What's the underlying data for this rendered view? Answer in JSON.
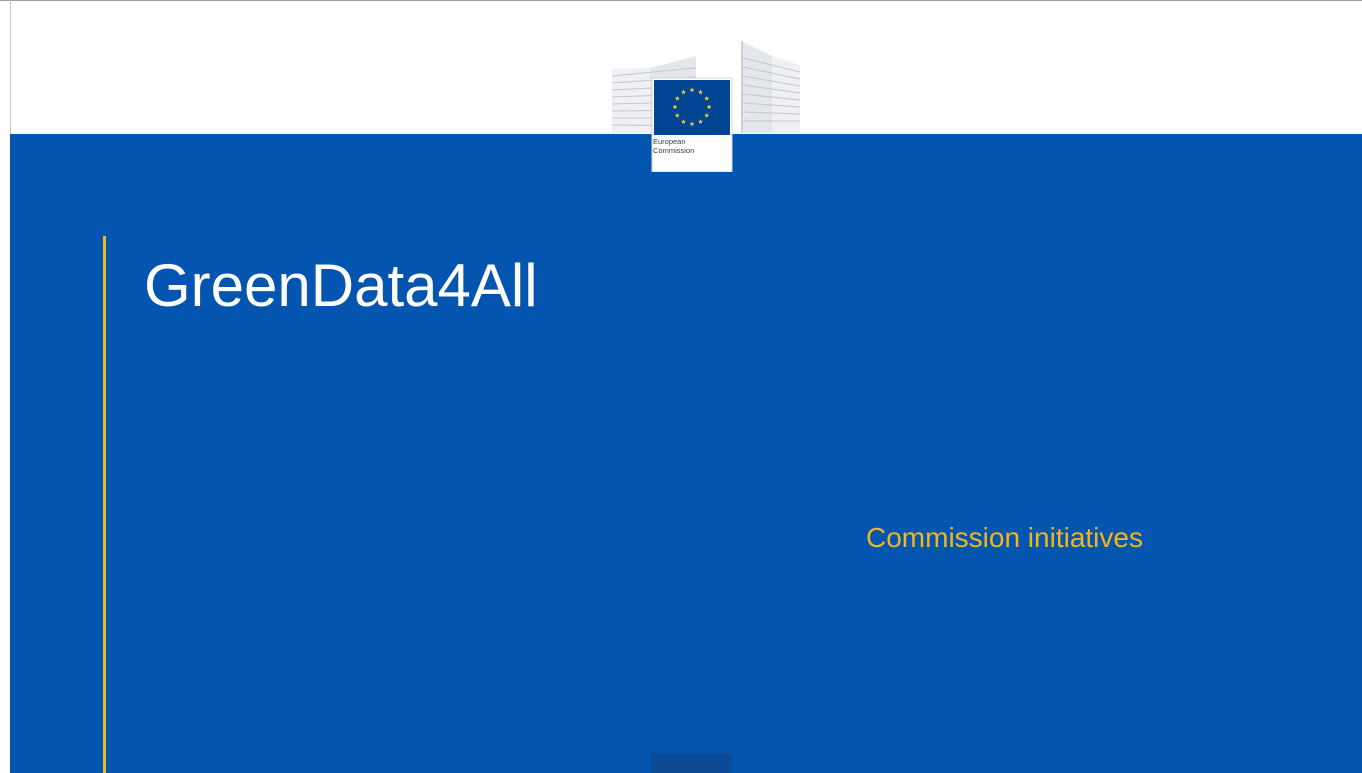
{
  "logo": {
    "icon": "european-commission-logo-icon",
    "line1": "European",
    "line2": "Commission"
  },
  "slide": {
    "title": "GreenData4All",
    "subtitle": "Commission initiatives"
  },
  "colors": {
    "band_blue": "#0455b0",
    "accent_yellow": "#f2b51a",
    "flag_blue": "#004494",
    "star_yellow": "#ffd617",
    "title_white": "#ffffff"
  }
}
